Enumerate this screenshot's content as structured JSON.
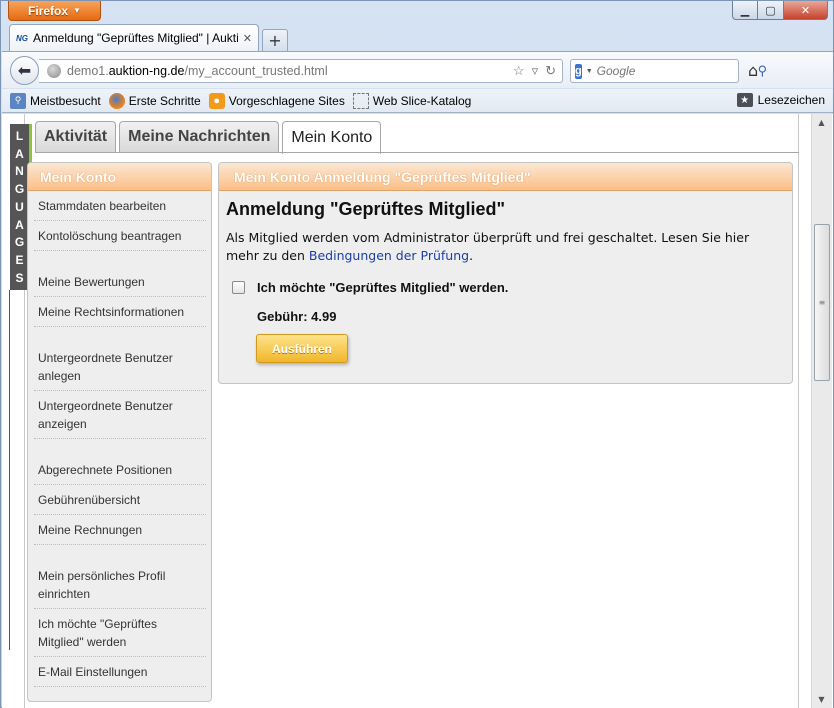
{
  "browser": {
    "menu_button": "Firefox",
    "tab_title": "Anmeldung \"Geprüftes Mitglied\" | Aukti…",
    "tab_favicon": "NG",
    "url_domain": "demo1.auktion-ng.de",
    "url_path": "/my_account_trusted.html",
    "url_prefix": "demo1.",
    "url_host": "auktion-ng.de",
    "search_placeholder": "Google",
    "bookmarks": [
      {
        "label": "Meistbesucht",
        "icon": "most-visited-icon"
      },
      {
        "label": "Erste Schritte",
        "icon": "firefox-icon"
      },
      {
        "label": "Vorgeschlagene Sites",
        "icon": "bulb-icon"
      },
      {
        "label": "Web Slice-Katalog",
        "icon": "web-slice-icon"
      }
    ],
    "bookmarks_menu": "Lesezeichen"
  },
  "page": {
    "languages_tab": [
      "L",
      "A",
      "N",
      "G",
      "U",
      "A",
      "G",
      "E",
      "S"
    ],
    "tabs": [
      {
        "label": "Aktivität",
        "active": false
      },
      {
        "label": "Meine Nachrichten",
        "active": false
      },
      {
        "label": "Mein Konto",
        "active": true
      }
    ],
    "sidebar": {
      "title": "Mein Konto",
      "items": [
        {
          "label": "Stammdaten bearbeiten",
          "gap": false
        },
        {
          "label": "Kontolöschung beantragen",
          "gap": false
        },
        {
          "label": "Meine Bewertungen",
          "gap": true
        },
        {
          "label": "Meine Rechtsinformationen",
          "gap": false
        },
        {
          "label": "Untergeordnete Benutzer anlegen",
          "gap": true
        },
        {
          "label": "Untergeordnete Benutzer anzeigen",
          "gap": false
        },
        {
          "label": "Abgerechnete Positionen",
          "gap": true
        },
        {
          "label": "Gebührenübersicht",
          "gap": false
        },
        {
          "label": "Meine Rechnungen",
          "gap": false
        },
        {
          "label": "Mein persönliches Profil einrichten",
          "gap": true
        },
        {
          "label": "Ich möchte \"Geprüftes Mitglied\" werden",
          "gap": false
        },
        {
          "label": "E-Mail Einstellungen",
          "gap": false
        }
      ]
    },
    "main": {
      "panel_title": "Mein Konto Anmeldung \"Geprüftes Mitglied\"",
      "heading": "Anmeldung \"Geprüftes Mitglied\"",
      "text_before_link": "Als Mitglied werden vom Administrator überprüft und frei geschaltet. Lesen Sie hier mehr zu den ",
      "link_text": "Bedingungen der Prüfung",
      "text_after_link": ".",
      "checkbox_label": "Ich möchte \"Geprüftes Mitglied\" werden.",
      "checkbox_checked": false,
      "fee_label": "Gebühr: 4.99",
      "submit_label": "Ausführen"
    }
  },
  "colors": {
    "panel_header": "#fbbf86",
    "button": "#f1b62a",
    "link": "#1a3fa3",
    "language_accent": "#8cc43d"
  }
}
